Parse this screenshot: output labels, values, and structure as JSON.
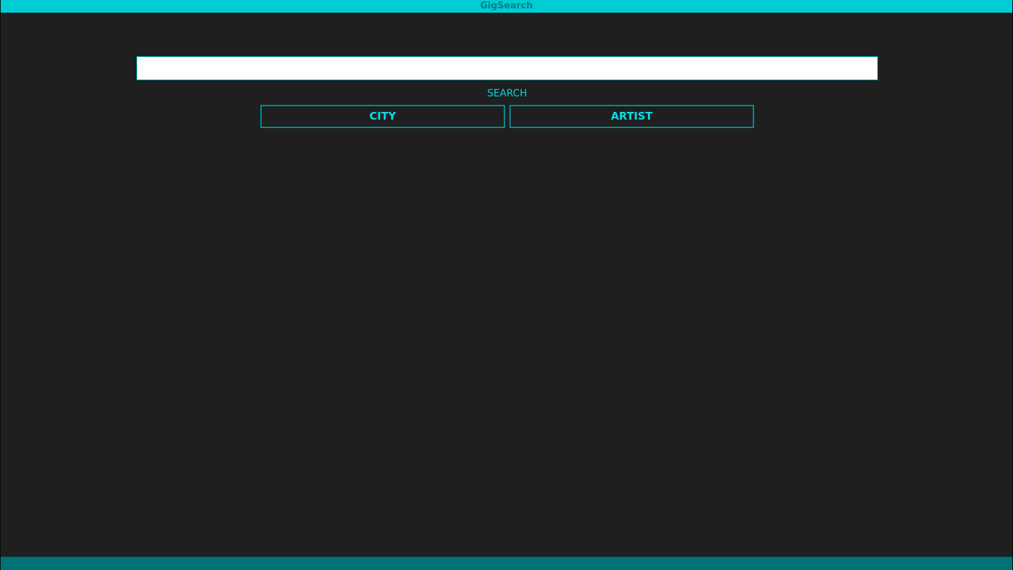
{
  "window": {
    "title": "GigSearch"
  },
  "search": {
    "value": "",
    "placeholder": "",
    "label": "SEARCH"
  },
  "buttons": {
    "city": "CITY",
    "artist": "ARTIST"
  },
  "colors": {
    "accent": "#00ccd4",
    "title_text": "#00818a",
    "button_border": "#008c94",
    "button_text": "#00e0ea",
    "background": "#1f1f1f",
    "bottom_bar": "#007378"
  }
}
